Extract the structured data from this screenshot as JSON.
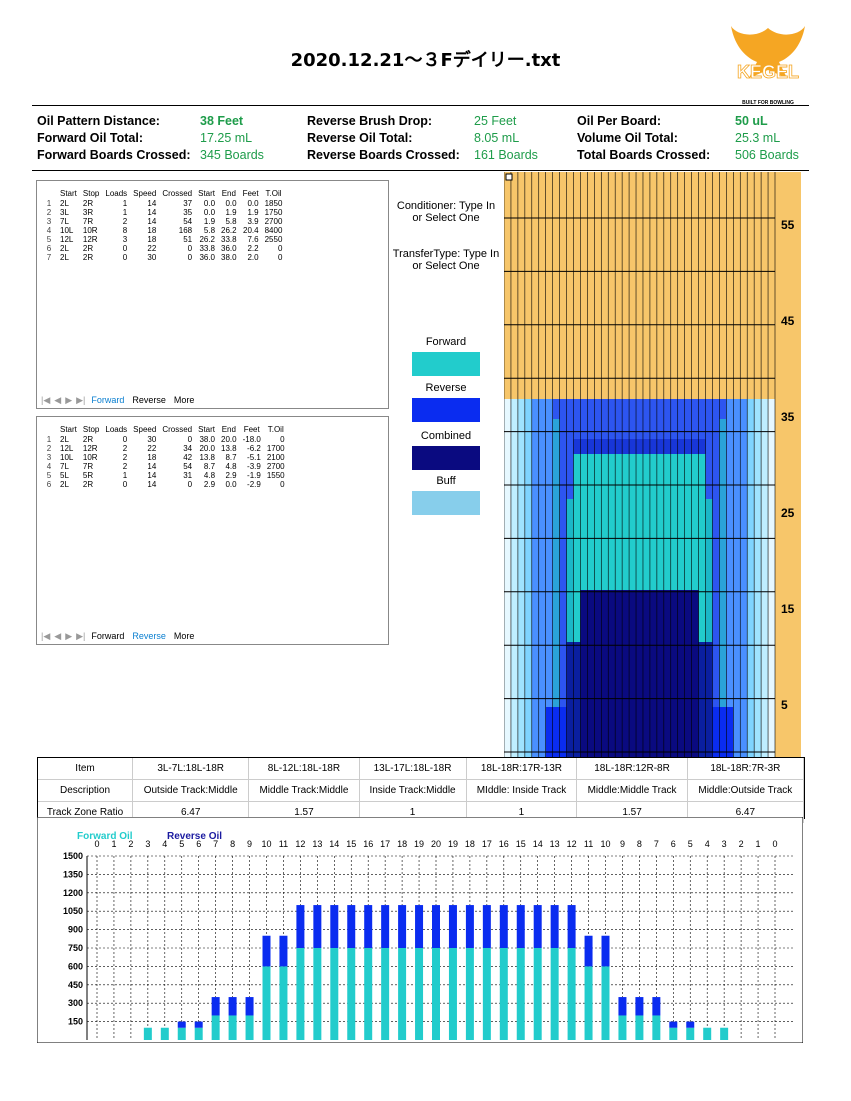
{
  "title": "2020.12.21～３Fデイリー.txt",
  "logo": {
    "brand": "KEGEL",
    "tagline": "BUILT FOR BOWLING"
  },
  "stats": [
    {
      "label": "Oil Pattern Distance:",
      "value": "38 Feet",
      "bold": true
    },
    {
      "label": "Forward Oil Total:",
      "value": "17.25 mL",
      "bold": false
    },
    {
      "label": "Forward Boards Crossed:",
      "value": "345 Boards",
      "bold": false
    },
    {
      "label": "Reverse Brush Drop:",
      "value": "25 Feet",
      "bold": false
    },
    {
      "label": "Reverse Oil Total:",
      "value": "8.05 mL",
      "bold": false
    },
    {
      "label": "Reverse Boards Crossed:",
      "value": "161 Boards",
      "bold": false
    },
    {
      "label": "Oil Per Board:",
      "value": "50 uL",
      "bold": true
    },
    {
      "label": "Volume Oil Total:",
      "value": "25.3 mL",
      "bold": false
    },
    {
      "label": "Total Boards Crossed:",
      "value": "506 Boards",
      "bold": false
    }
  ],
  "columns": [
    "",
    "Start",
    "Stop",
    "Loads",
    "Speed",
    "Crossed",
    "Start",
    "End",
    "Feet",
    "T.Oil"
  ],
  "forward_rows": [
    [
      "1",
      "2L",
      "2R",
      "1",
      "14",
      "37",
      "0.0",
      "0.0",
      "0.0",
      "1850"
    ],
    [
      "2",
      "3L",
      "3R",
      "1",
      "14",
      "35",
      "0.0",
      "1.9",
      "1.9",
      "1750"
    ],
    [
      "3",
      "7L",
      "7R",
      "2",
      "14",
      "54",
      "1.9",
      "5.8",
      "3.9",
      "2700"
    ],
    [
      "4",
      "10L",
      "10R",
      "8",
      "18",
      "168",
      "5.8",
      "26.2",
      "20.4",
      "8400"
    ],
    [
      "5",
      "12L",
      "12R",
      "3",
      "18",
      "51",
      "26.2",
      "33.8",
      "7.6",
      "2550"
    ],
    [
      "6",
      "2L",
      "2R",
      "0",
      "22",
      "0",
      "33.8",
      "36.0",
      "2.2",
      "0"
    ],
    [
      "7",
      "2L",
      "2R",
      "0",
      "30",
      "0",
      "36.0",
      "38.0",
      "2.0",
      "0"
    ]
  ],
  "reverse_rows": [
    [
      "1",
      "2L",
      "2R",
      "0",
      "30",
      "0",
      "38.0",
      "20.0",
      "-18.0",
      "0"
    ],
    [
      "2",
      "12L",
      "12R",
      "2",
      "22",
      "34",
      "20.0",
      "13.8",
      "-6.2",
      "1700"
    ],
    [
      "3",
      "10L",
      "10R",
      "2",
      "18",
      "42",
      "13.8",
      "8.7",
      "-5.1",
      "2100"
    ],
    [
      "4",
      "7L",
      "7R",
      "2",
      "14",
      "54",
      "8.7",
      "4.8",
      "-3.9",
      "2700"
    ],
    [
      "5",
      "5L",
      "5R",
      "1",
      "14",
      "31",
      "4.8",
      "2.9",
      "-1.9",
      "1550"
    ],
    [
      "6",
      "2L",
      "2R",
      "0",
      "14",
      "0",
      "2.9",
      "0.0",
      "-2.9",
      "0"
    ]
  ],
  "tabs": {
    "forward": "Forward",
    "reverse": "Reverse",
    "more": "More"
  },
  "conditioner": "Conditioner: Type In or Select One",
  "transfer": "TransferType: Type In or Select One",
  "legend": [
    {
      "label": "Forward",
      "color": "#22cccc"
    },
    {
      "label": "Reverse",
      "color": "#0a2cf0"
    },
    {
      "label": "Combined",
      "color": "#0a0a80"
    },
    {
      "label": "Buff",
      "color": "#87ceeb"
    }
  ],
  "lane_ft_labels": [
    "55",
    "45",
    "35",
    "25",
    "15",
    "5"
  ],
  "zone": {
    "headers": [
      "Item",
      "3L-7L:18L-18R",
      "8L-12L:18L-18R",
      "13L-17L:18L-18R",
      "18L-18R:17R-13R",
      "18L-18R:12R-8R",
      "18L-18R:7R-3R"
    ],
    "descriptions": [
      "Description",
      "Outside Track:Middle",
      "Middle Track:Middle",
      "Inside Track:Middle",
      "MIddle: Inside Track",
      "Middle:Middle Track",
      "Middle:Outside Track"
    ],
    "ratios": [
      "Track Zone Ratio",
      "6.47",
      "1.57",
      "1",
      "1",
      "1.57",
      "6.47"
    ]
  },
  "chart_data": {
    "type": "bar",
    "title": "",
    "legend": [
      "Forward Oil",
      "Reverse Oil"
    ],
    "categories": [
      "0",
      "1",
      "2",
      "3",
      "4",
      "5",
      "6",
      "7",
      "8",
      "9",
      "10",
      "11",
      "12",
      "13",
      "14",
      "15",
      "16",
      "17",
      "18",
      "19",
      "20",
      "19",
      "18",
      "17",
      "16",
      "15",
      "14",
      "13",
      "12",
      "11",
      "10",
      "9",
      "8",
      "7",
      "6",
      "5",
      "4",
      "3",
      "2",
      "1",
      "0"
    ],
    "series": [
      {
        "name": "Forward Oil",
        "color": "#22cccc",
        "values": [
          0,
          0,
          0,
          100,
          100,
          100,
          100,
          200,
          200,
          200,
          600,
          600,
          750,
          750,
          750,
          750,
          750,
          750,
          750,
          750,
          750,
          750,
          750,
          750,
          750,
          750,
          750,
          750,
          750,
          600,
          600,
          200,
          200,
          200,
          100,
          100,
          100,
          100,
          0,
          0,
          0
        ]
      },
      {
        "name": "Reverse Oil",
        "color": "#0a2cf0",
        "values": [
          0,
          0,
          0,
          0,
          0,
          50,
          50,
          150,
          150,
          150,
          250,
          250,
          350,
          350,
          350,
          350,
          350,
          350,
          350,
          350,
          350,
          350,
          350,
          350,
          350,
          350,
          350,
          350,
          350,
          250,
          250,
          150,
          150,
          150,
          50,
          50,
          0,
          0,
          0,
          0,
          0
        ]
      }
    ],
    "yticks": [
      150,
      300,
      450,
      600,
      750,
      900,
      1050,
      1200,
      1350,
      1500
    ],
    "ylim": [
      0,
      1500
    ]
  }
}
